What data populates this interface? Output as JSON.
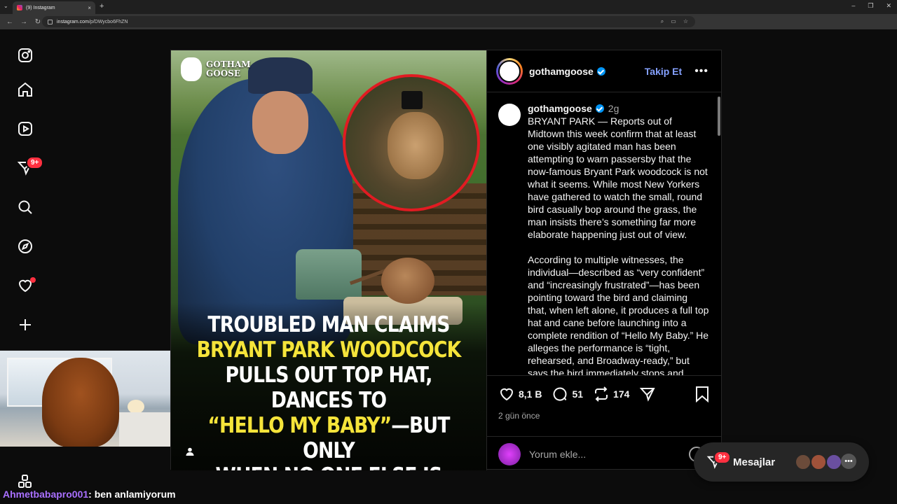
{
  "browser": {
    "tab_title": "(9) Instagram",
    "tab_close": "×",
    "new_tab": "+",
    "url_host": "instagram.com",
    "url_path": "/p/DWycbo6FhZN"
  },
  "sidebar": {
    "items": [
      {
        "name": "instagram-logo"
      },
      {
        "name": "home"
      },
      {
        "name": "reels"
      },
      {
        "name": "messages",
        "badge": "9+"
      },
      {
        "name": "search"
      },
      {
        "name": "explore"
      },
      {
        "name": "notifications"
      },
      {
        "name": "create"
      },
      {
        "name": "more"
      }
    ]
  },
  "stream": {
    "chat_user": "Ahmetbabapro001",
    "chat_message": ": ben anlamiyorum"
  },
  "post": {
    "media": {
      "brand_line1": "GOTHAM",
      "brand_line2": "GOOSE",
      "headline_line1": "TROUBLED MAN CLAIMS",
      "headline_line2": "BRYANT PARK WOODCOCK",
      "headline_line3": "PULLS OUT TOP HAT, DANCES TO",
      "headline_line4_yellow": "“HELLO MY BABY”",
      "headline_line4_rest": "—BUT ONLY",
      "headline_line5": "WHEN NO ONE ELSE IS LOOKING"
    },
    "header": {
      "username": "gothamgoose",
      "follow_label": "Takip Et",
      "more_label": "•••"
    },
    "caption": {
      "username": "gothamgoose",
      "time": "2g",
      "paragraph1": "BRYANT PARK — Reports out of Midtown this week confirm that at least one visibly agitated man has been attempting to warn passersby that the now-famous Bryant Park woodcock is not what it seems. While most New Yorkers have gathered to watch the small, round bird casually bop around the grass, the man insists there’s something far more elaborate happening just out of view.",
      "paragraph2": "According to multiple witnesses, the individual—described as “very confident” and “increasingly frustrated”—has been pointing toward the bird and claiming that, when left alone, it produces a full top hat and cane before launching into a complete rendition of “Hello My Baby.” He alleges the performance is “tight, rehearsed, and Broadway-ready,” but says the bird immediately stops and “goes"
    },
    "actions": {
      "likes": "8,1 B",
      "comments": "51",
      "reposts": "174",
      "posted_ago": "2 gün önce",
      "comment_placeholder": "Yorum ekle..."
    }
  },
  "messages_pill": {
    "label": "Mesajlar",
    "badge": "9+",
    "more": "•••"
  },
  "colors": {
    "background": "#000000",
    "accent_link": "#85a1ff",
    "verified": "#0095f6",
    "badge_red": "#ff3040",
    "headline_yellow": "#f5e43a",
    "chat_user": "#a970ff"
  }
}
